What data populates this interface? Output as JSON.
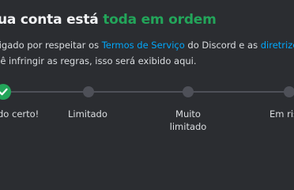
{
  "header": {
    "title_prefix": "ua conta está ",
    "title_highlight": "toda em ordem"
  },
  "description": {
    "line1_before": "rigado por respeitar os ",
    "line1_link1": "Termos de Serviço",
    "line1_middle": " do Discord e as ",
    "line1_link2": "diretrizes",
    "line2": "cê infringir as regras, isso será exibido aqui."
  },
  "status_steps": [
    {
      "label": "do certo!",
      "active": true
    },
    {
      "label": "Limitado",
      "active": false
    },
    {
      "label": "Muito limitado",
      "active": false
    },
    {
      "label": "Em ris",
      "active": false
    }
  ],
  "colors": {
    "background": "#2b2d31",
    "success": "#23a55a",
    "link": "#00a8fc",
    "track": "#4e5058"
  },
  "icons": {
    "active_step": "checkmark-icon"
  }
}
